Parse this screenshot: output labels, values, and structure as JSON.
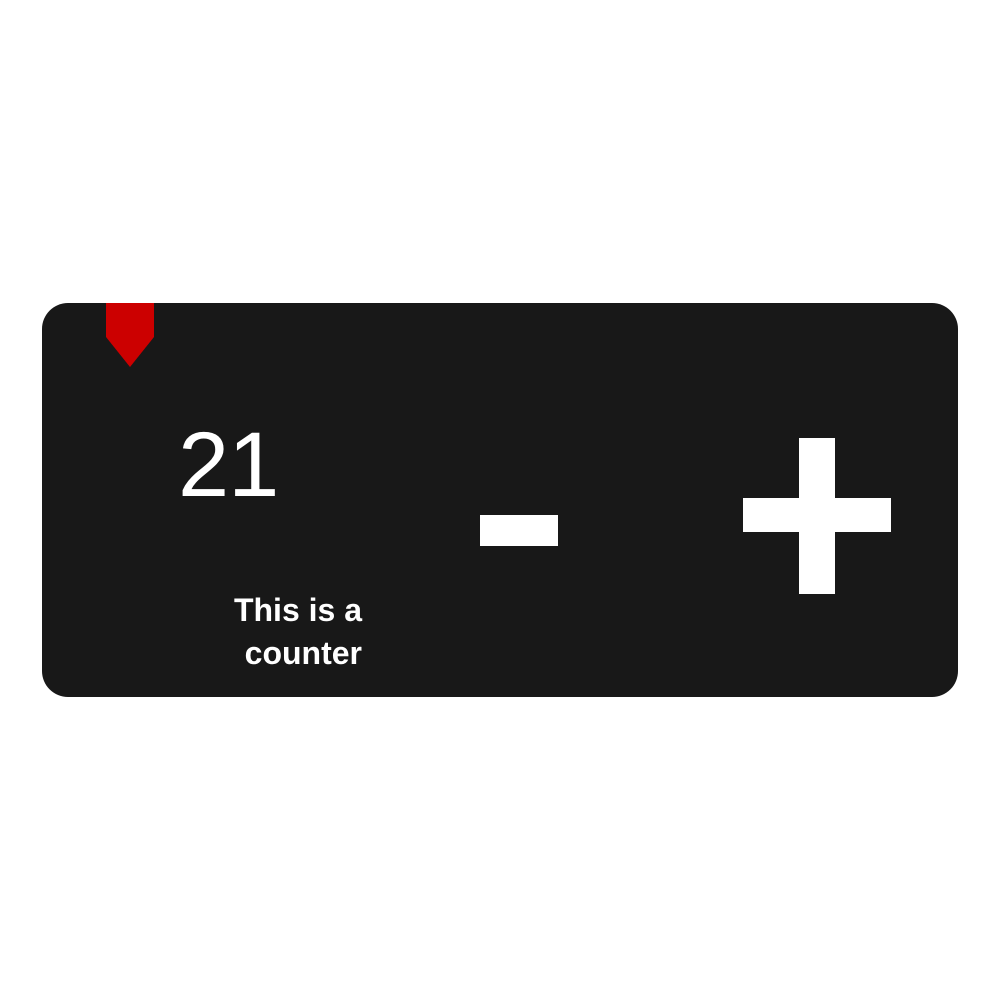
{
  "counter": {
    "value": "21",
    "caption_line1": "This is a",
    "caption_line2": "counter"
  },
  "controls": {
    "decrement_icon": "minus-icon",
    "increment_icon": "plus-icon"
  },
  "marker": {
    "icon": "bookmark-icon",
    "color": "#cc0000"
  },
  "colors": {
    "card_background": "#181818",
    "foreground": "#ffffff",
    "page_background": "#ffffff"
  }
}
